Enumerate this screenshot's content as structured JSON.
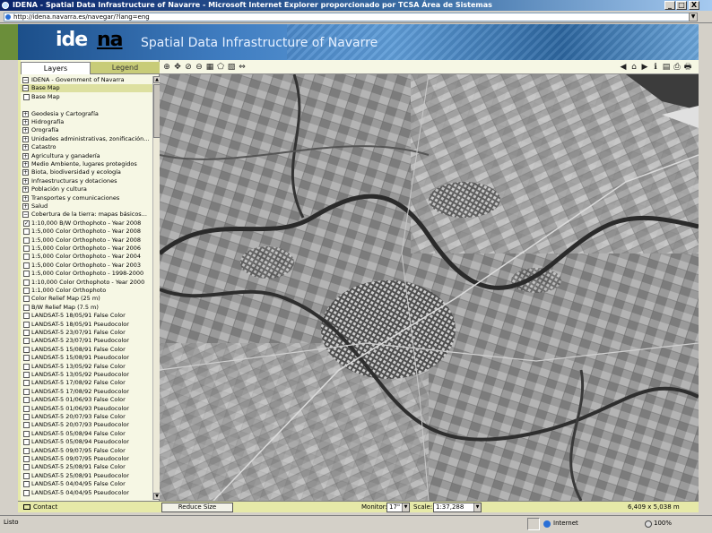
{
  "window": {
    "title": "IDENA - Spatial Data Infrastructure of Navarre - Microsoft Internet Explorer proporcionado por TCSA Área de Sistemas",
    "controls": [
      "_",
      "□",
      "X"
    ]
  },
  "address": {
    "url": "http://idena.navarra.es/navegar/?lang=eng"
  },
  "banner": {
    "logo_main": "ide",
    "logo_accent": "na",
    "title": "Spatial Data Infrastructure of Navarre"
  },
  "tabs": {
    "layers": "Layers",
    "legend": "Legend"
  },
  "layers": [
    {
      "label": "IDENA - Government of Navarra",
      "type": "group",
      "mark": "−"
    },
    {
      "label": "Base Map",
      "type": "group",
      "mark": "−",
      "highlight": true
    },
    {
      "label": "Base Map",
      "type": "item",
      "mark": ""
    },
    {
      "label": "",
      "type": "spacer",
      "mark": ""
    },
    {
      "label": "Geodesia y Cartografía",
      "type": "group",
      "mark": "+"
    },
    {
      "label": "Hidrografía",
      "type": "group",
      "mark": "+"
    },
    {
      "label": "Orografía",
      "type": "group",
      "mark": "+"
    },
    {
      "label": "Unidades administrativas, zonificación...",
      "type": "group",
      "mark": "+"
    },
    {
      "label": "Catastro",
      "type": "group",
      "mark": "+"
    },
    {
      "label": "Agricultura y ganadería",
      "type": "group",
      "mark": "+"
    },
    {
      "label": "Medio Ambiente, lugares protegidos",
      "type": "group",
      "mark": "+"
    },
    {
      "label": "Biota, biodiversidad y ecología",
      "type": "group",
      "mark": "+"
    },
    {
      "label": "Infraestructuras y dotaciones",
      "type": "group",
      "mark": "+"
    },
    {
      "label": "Población y cultura",
      "type": "group",
      "mark": "+"
    },
    {
      "label": "Transportes y comunicaciones",
      "type": "group",
      "mark": "+"
    },
    {
      "label": "Salud",
      "type": "group",
      "mark": "+"
    },
    {
      "label": "Cobertura de la tierra: mapas básicos...",
      "type": "group",
      "mark": "−"
    },
    {
      "label": "1:10,000 B/W Orthophoto - Year 2008",
      "type": "item",
      "mark": "✓"
    },
    {
      "label": "1:5,000 Color Orthophoto - Year 2008",
      "type": "item",
      "mark": ""
    },
    {
      "label": "1:5,000 Color Orthophoto - Year 2008",
      "type": "item",
      "mark": ""
    },
    {
      "label": "1:5,000 Color Orthophoto - Year 2006",
      "type": "item",
      "mark": ""
    },
    {
      "label": "1:5,000 Color Orthophoto - Year 2004",
      "type": "item",
      "mark": ""
    },
    {
      "label": "1:5,000 Color Orthophoto - Year 2003",
      "type": "item",
      "mark": ""
    },
    {
      "label": "1:5,000 Color Orthophoto - 1998-2000",
      "type": "item",
      "mark": ""
    },
    {
      "label": "1:10,000 Color Orthophoto - Year 2000",
      "type": "item",
      "mark": ""
    },
    {
      "label": "1:1,000 Color Orthophoto",
      "type": "item",
      "mark": ""
    },
    {
      "label": "Color Relief Map (25 m)",
      "type": "item",
      "mark": ""
    },
    {
      "label": "B/W Relief Map (7.5 m)",
      "type": "item",
      "mark": ""
    },
    {
      "label": "LANDSAT-5 18/05/91 False Color",
      "type": "item",
      "mark": ""
    },
    {
      "label": "LANDSAT-5 18/05/91 Pseudocolor",
      "type": "item",
      "mark": ""
    },
    {
      "label": "LANDSAT-5 23/07/91 False Color",
      "type": "item",
      "mark": ""
    },
    {
      "label": "LANDSAT-5 23/07/91 Pseudocolor",
      "type": "item",
      "mark": ""
    },
    {
      "label": "LANDSAT-5 15/08/91 False Color",
      "type": "item",
      "mark": ""
    },
    {
      "label": "LANDSAT-5 15/08/91 Pseudocolor",
      "type": "item",
      "mark": ""
    },
    {
      "label": "LANDSAT-5 13/05/92 False Color",
      "type": "item",
      "mark": ""
    },
    {
      "label": "LANDSAT-5 13/05/92 Pseudocolor",
      "type": "item",
      "mark": ""
    },
    {
      "label": "LANDSAT-5 17/08/92 False Color",
      "type": "item",
      "mark": ""
    },
    {
      "label": "LANDSAT-5 17/08/92 Pseudocolor",
      "type": "item",
      "mark": ""
    },
    {
      "label": "LANDSAT-5 01/06/93 False Color",
      "type": "item",
      "mark": ""
    },
    {
      "label": "LANDSAT-5 01/06/93 Pseudocolor",
      "type": "item",
      "mark": ""
    },
    {
      "label": "LANDSAT-5 20/07/93 False Color",
      "type": "item",
      "mark": ""
    },
    {
      "label": "LANDSAT-5 20/07/93 Pseudocolor",
      "type": "item",
      "mark": ""
    },
    {
      "label": "LANDSAT-5 05/08/94 False Color",
      "type": "item",
      "mark": ""
    },
    {
      "label": "LANDSAT-5 05/08/94 Pseudocolor",
      "type": "item",
      "mark": ""
    },
    {
      "label": "LANDSAT-5 09/07/95 False Color",
      "type": "item",
      "mark": ""
    },
    {
      "label": "LANDSAT-5 09/07/95 Pseudocolor",
      "type": "item",
      "mark": ""
    },
    {
      "label": "LANDSAT-5 25/08/91 False Color",
      "type": "item",
      "mark": ""
    },
    {
      "label": "LANDSAT-5 25/08/91 Pseudocolor",
      "type": "item",
      "mark": ""
    },
    {
      "label": "LANDSAT-5 04/04/95 False Color",
      "type": "item",
      "mark": ""
    },
    {
      "label": "LANDSAT-5 04/04/95 Pseudocolor",
      "type": "item",
      "mark": ""
    }
  ],
  "map_tools": {
    "left": [
      {
        "icon": "zoom-in-icon",
        "glyph": "⊕"
      },
      {
        "icon": "pan-icon",
        "glyph": "✥"
      },
      {
        "icon": "measure-icon",
        "glyph": "⊘"
      },
      {
        "icon": "zoom-out-icon",
        "glyph": "⊖"
      },
      {
        "icon": "zoom-box-icon",
        "glyph": "▦"
      },
      {
        "icon": "polygon-select-icon",
        "glyph": "⬠"
      },
      {
        "icon": "layers-icon",
        "glyph": "▧"
      },
      {
        "icon": "scale-icon",
        "glyph": "⇔"
      }
    ],
    "right": [
      {
        "icon": "back-arrow-icon",
        "glyph": "◀"
      },
      {
        "icon": "home-icon",
        "glyph": "⌂"
      },
      {
        "icon": "forward-arrow-icon",
        "glyph": "▶"
      },
      {
        "icon": "info-icon",
        "glyph": "ℹ"
      },
      {
        "icon": "print-preview-icon",
        "glyph": "▤"
      },
      {
        "icon": "export-icon",
        "glyph": "⎙"
      },
      {
        "icon": "printer-icon",
        "glyph": "🖶"
      }
    ]
  },
  "bottom": {
    "contact": "Contact",
    "reduce_size": "Reduce Size",
    "monitor_label": "Monitor:",
    "monitor_value": "17\"",
    "scale_label": "Scale:",
    "scale_value": "1:37,288",
    "coords": "6,409 x 5,038 m"
  },
  "status": {
    "left": "Listo",
    "zone": "Internet",
    "zoom": "100%"
  },
  "colors": {
    "panel_bg": "#f6f7e4",
    "frame_accent": "#e6e9a8",
    "title_bar": "#0a246a"
  }
}
